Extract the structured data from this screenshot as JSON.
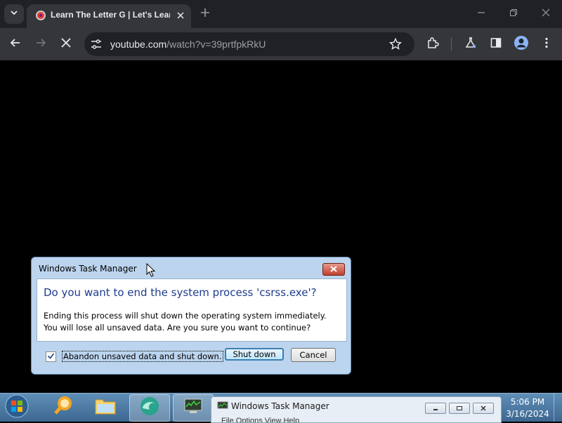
{
  "browser": {
    "tab": {
      "title": "Learn The Letter G | Let's Learn"
    },
    "omnibox": {
      "host": "youtube.com",
      "path": "/watch?v=39prtfpkRkU"
    }
  },
  "dialog": {
    "title": "Windows Task Manager",
    "heading": "Do you want to end the system process 'csrss.exe'?",
    "message": "Ending this process will shut down the operating system immediately.  You will lose all unsaved data.  Are you sure you want to continue?",
    "checkbox_label": "Abandon unsaved data and shut down.",
    "checkbox_checked": true,
    "shutdown_label": "Shut down",
    "cancel_label": "Cancel"
  },
  "taskbar": {
    "window_title": "Windows Task Manager",
    "window_menu": "File   Options   View   Help",
    "time": "5:06 PM",
    "date": "3/16/2024"
  },
  "colors": {
    "accent": "#1e3c8c",
    "dialog_frame": "#bcd4ee",
    "chrome_dark": "#202124"
  }
}
